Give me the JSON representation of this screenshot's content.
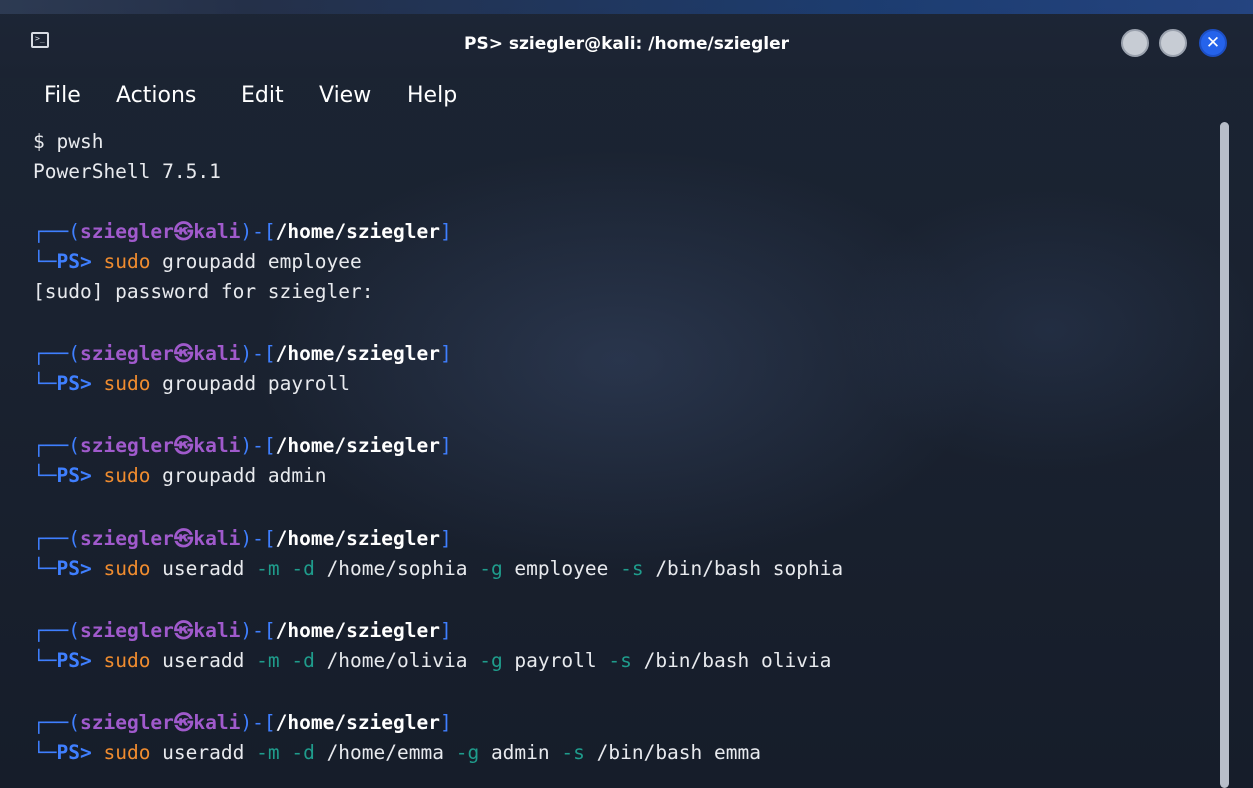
{
  "window": {
    "title": "PS> sziegler@kali: /home/sziegler",
    "icon": "terminal-icon",
    "controls": [
      "minimize-button",
      "maximize-button",
      "close-button"
    ],
    "close_glyph": "✕"
  },
  "menu": {
    "file": "File",
    "actions": "Actions",
    "edit": "Edit",
    "view": "View",
    "help": "Help"
  },
  "terminal": {
    "intro": {
      "shell_cmd": "$ pwsh",
      "version": "PowerShell 7.5.1"
    },
    "prompt": {
      "top_left": "┌──",
      "open_paren": "(",
      "user": "sziegler",
      "at": "㉿",
      "host": "kali",
      "close_paren": ")",
      "dash": "-",
      "open_bracket": "[",
      "cwd": "/home/sziegler",
      "close_bracket": "]",
      "bottom_left": "└─",
      "ps": "PS>"
    },
    "blocks": [
      {
        "sudo": "sudo",
        "parts": [
          {
            "text": " groupadd employee",
            "kind": "cmd"
          }
        ],
        "output": "[sudo] password for sziegler:"
      },
      {
        "sudo": "sudo",
        "parts": [
          {
            "text": " groupadd payroll",
            "kind": "cmd"
          }
        ],
        "output": ""
      },
      {
        "sudo": "sudo",
        "parts": [
          {
            "text": " groupadd admin",
            "kind": "cmd"
          }
        ],
        "output": ""
      },
      {
        "sudo": "sudo",
        "parts": [
          {
            "text": " useradd ",
            "kind": "cmd"
          },
          {
            "text": "-m",
            "kind": "flag"
          },
          {
            "text": " ",
            "kind": "cmd"
          },
          {
            "text": "-d",
            "kind": "flag"
          },
          {
            "text": " /home/sophia ",
            "kind": "cmd"
          },
          {
            "text": "-g",
            "kind": "flag"
          },
          {
            "text": " employee ",
            "kind": "cmd"
          },
          {
            "text": "-s",
            "kind": "flag"
          },
          {
            "text": " /bin/bash sophia",
            "kind": "cmd"
          }
        ],
        "output": ""
      },
      {
        "sudo": "sudo",
        "parts": [
          {
            "text": " useradd ",
            "kind": "cmd"
          },
          {
            "text": "-m",
            "kind": "flag"
          },
          {
            "text": " ",
            "kind": "cmd"
          },
          {
            "text": "-d",
            "kind": "flag"
          },
          {
            "text": " /home/olivia ",
            "kind": "cmd"
          },
          {
            "text": "-g",
            "kind": "flag"
          },
          {
            "text": " payroll ",
            "kind": "cmd"
          },
          {
            "text": "-s",
            "kind": "flag"
          },
          {
            "text": " /bin/bash olivia",
            "kind": "cmd"
          }
        ],
        "output": ""
      },
      {
        "sudo": "sudo",
        "parts": [
          {
            "text": " useradd ",
            "kind": "cmd"
          },
          {
            "text": "-m",
            "kind": "flag"
          },
          {
            "text": " ",
            "kind": "cmd"
          },
          {
            "text": "-d",
            "kind": "flag"
          },
          {
            "text": " /home/emma ",
            "kind": "cmd"
          },
          {
            "text": "-g",
            "kind": "flag"
          },
          {
            "text": " admin ",
            "kind": "cmd"
          },
          {
            "text": "-s",
            "kind": "flag"
          },
          {
            "text": " /bin/bash emma",
            "kind": "cmd"
          }
        ],
        "output": ""
      }
    ]
  },
  "colors": {
    "bracket": "#3f7fff",
    "userhost": "#a05acc",
    "sudo": "#f08c2f",
    "flag": "#1f9c8c",
    "close_button": "#2563eb"
  }
}
